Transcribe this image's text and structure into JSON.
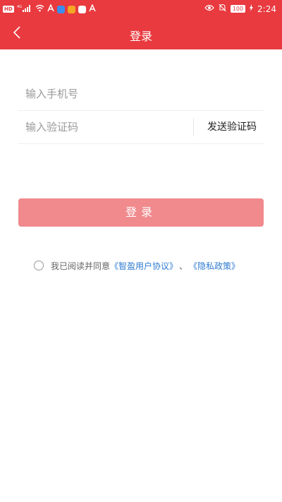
{
  "status_bar": {
    "left_badge": "HD",
    "signal_text": "4G",
    "time": "2:24",
    "battery": "100"
  },
  "header": {
    "title": "登录",
    "back_icon": "chevron-left-icon"
  },
  "form": {
    "phone_placeholder": "输入手机号",
    "code_placeholder": "输入验证码",
    "send_code_label": "发送验证码"
  },
  "login_button": {
    "label": "登录"
  },
  "agreement": {
    "prefix": "我已阅读并同意",
    "user_agreement": "《智盈用户协议》",
    "separator": "、",
    "privacy_policy": "《隐私政策》"
  },
  "colors": {
    "header_red": "#e83a3f",
    "button_disabled": "#f08a8d",
    "link_blue": "#2f7bd1"
  }
}
